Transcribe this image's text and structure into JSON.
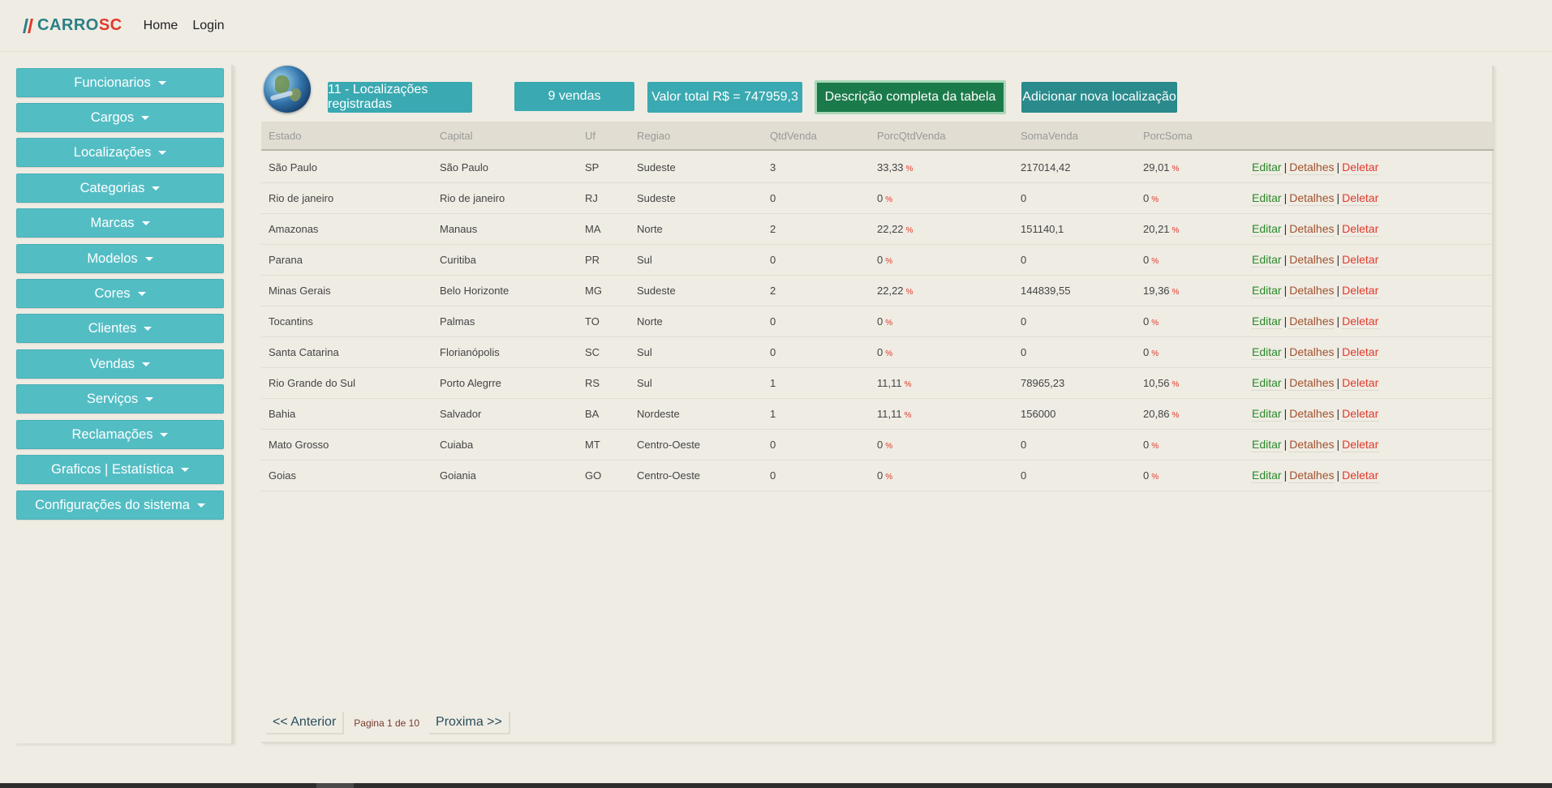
{
  "brand": {
    "name_prefix": "CARRO",
    "name_suffix": "SC"
  },
  "nav": {
    "home": "Home",
    "login": "Login"
  },
  "sidebar": {
    "items": [
      "Funcionarios",
      "Cargos",
      "Localizações",
      "Categorias",
      "Marcas",
      "Modelos",
      "Cores",
      "Clientes",
      "Vendas",
      "Serviços",
      "Reclamações",
      "Graficos | Estatística",
      "Configurações do sistema"
    ]
  },
  "summary": {
    "registered": "11 - Localizações registradas",
    "sales": "9 vendas",
    "total": "Valor total R$ = 747959,3",
    "full_desc": "Descrição completa da tabela",
    "add_new": "Adicionar nova localização"
  },
  "table": {
    "headers": [
      "Estado",
      "Capital",
      "Uf",
      "Regiao",
      "QtdVenda",
      "PorcQtdVenda",
      "SomaVenda",
      "PorcSoma"
    ],
    "pct_sign": "%",
    "actions": {
      "edit": "Editar",
      "details": "Detalhes",
      "delete": "Deletar",
      "sep": "|"
    },
    "rows": [
      [
        "São Paulo",
        "São Paulo",
        "SP",
        "Sudeste",
        "3",
        "33,33",
        "217014,42",
        "29,01"
      ],
      [
        "Rio de janeiro",
        "Rio de janeiro",
        "RJ",
        "Sudeste",
        "0",
        "0",
        "0",
        "0"
      ],
      [
        "Amazonas",
        "Manaus",
        "MA",
        "Norte",
        "2",
        "22,22",
        "151140,1",
        "20,21"
      ],
      [
        "Parana",
        "Curitiba",
        "PR",
        "Sul",
        "0",
        "0",
        "0",
        "0"
      ],
      [
        "Minas Gerais",
        "Belo Horizonte",
        "MG",
        "Sudeste",
        "2",
        "22,22",
        "144839,55",
        "19,36"
      ],
      [
        "Tocantins",
        "Palmas",
        "TO",
        "Norte",
        "0",
        "0",
        "0",
        "0"
      ],
      [
        "Santa Catarina",
        "Florianópolis",
        "SC",
        "Sul",
        "0",
        "0",
        "0",
        "0"
      ],
      [
        "Rio Grande do Sul",
        "Porto Alegrre",
        "RS",
        "Sul",
        "1",
        "11,11",
        "78965,23",
        "10,56"
      ],
      [
        "Bahia",
        "Salvador",
        "BA",
        "Nordeste",
        "1",
        "11,11",
        "156000",
        "20,86"
      ],
      [
        "Mato Grosso",
        "Cuiaba",
        "MT",
        "Centro-Oeste",
        "0",
        "0",
        "0",
        "0"
      ],
      [
        "Goias",
        "Goiania",
        "GO",
        "Centro-Oeste",
        "0",
        "0",
        "0",
        "0"
      ]
    ]
  },
  "pager": {
    "prev": "<< Anterior",
    "info": "Pagina 1 de 10",
    "next": "Proxima >>"
  }
}
